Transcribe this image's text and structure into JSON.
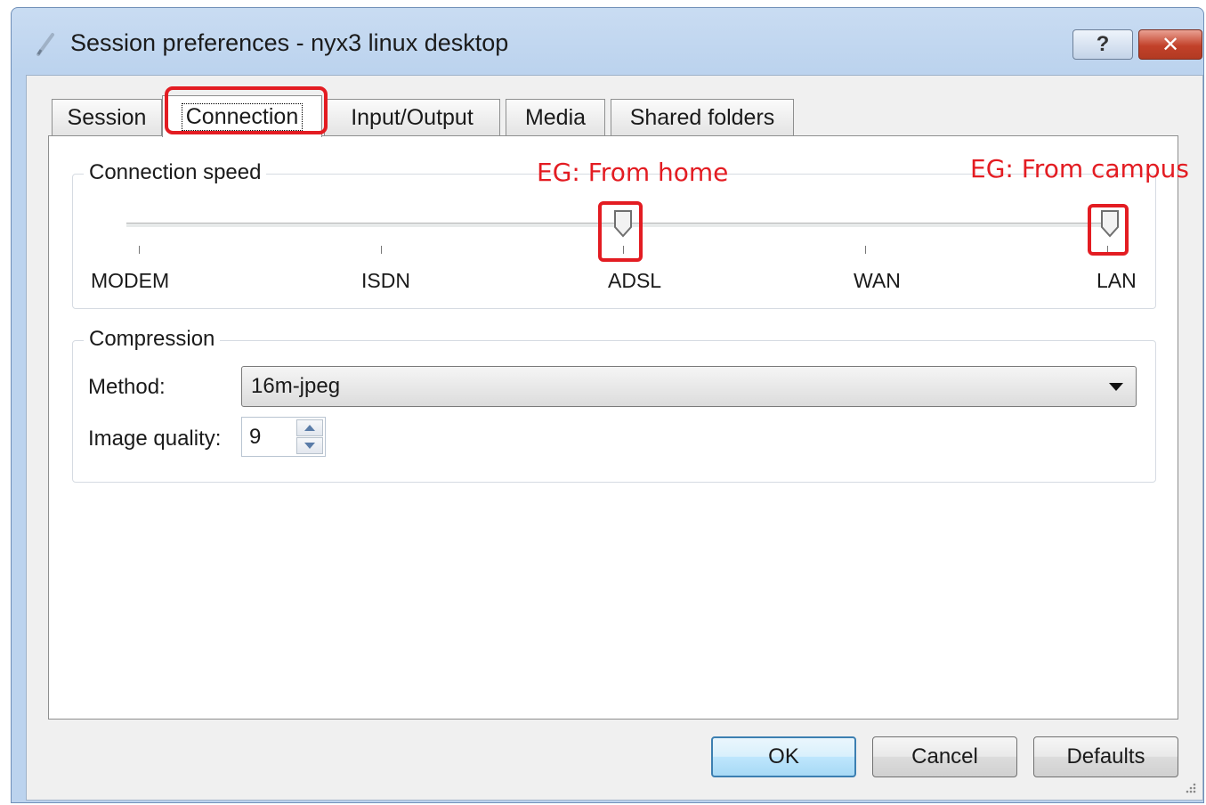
{
  "window": {
    "title": "Session preferences - nyx3 linux desktop",
    "help_label": "?",
    "close_label": "✕"
  },
  "tabs": [
    {
      "label": "Session",
      "active": false
    },
    {
      "label": "Connection",
      "active": true
    },
    {
      "label": "Input/Output",
      "active": false
    },
    {
      "label": "Media",
      "active": false
    },
    {
      "label": "Shared folders",
      "active": false
    }
  ],
  "connection_speed": {
    "title": "Connection speed",
    "levels": [
      "MODEM",
      "ISDN",
      "ADSL",
      "WAN",
      "LAN"
    ],
    "selected_level": "ADSL"
  },
  "annotations": {
    "home": "EG: From home",
    "campus": "EG: From campus",
    "color": "#e31c22"
  },
  "compression": {
    "title": "Compression",
    "method_label": "Method:",
    "method_value": "16m-jpeg",
    "quality_label": "Image quality:",
    "quality_value": "9"
  },
  "buttons": {
    "ok": "OK",
    "cancel": "Cancel",
    "defaults": "Defaults"
  }
}
